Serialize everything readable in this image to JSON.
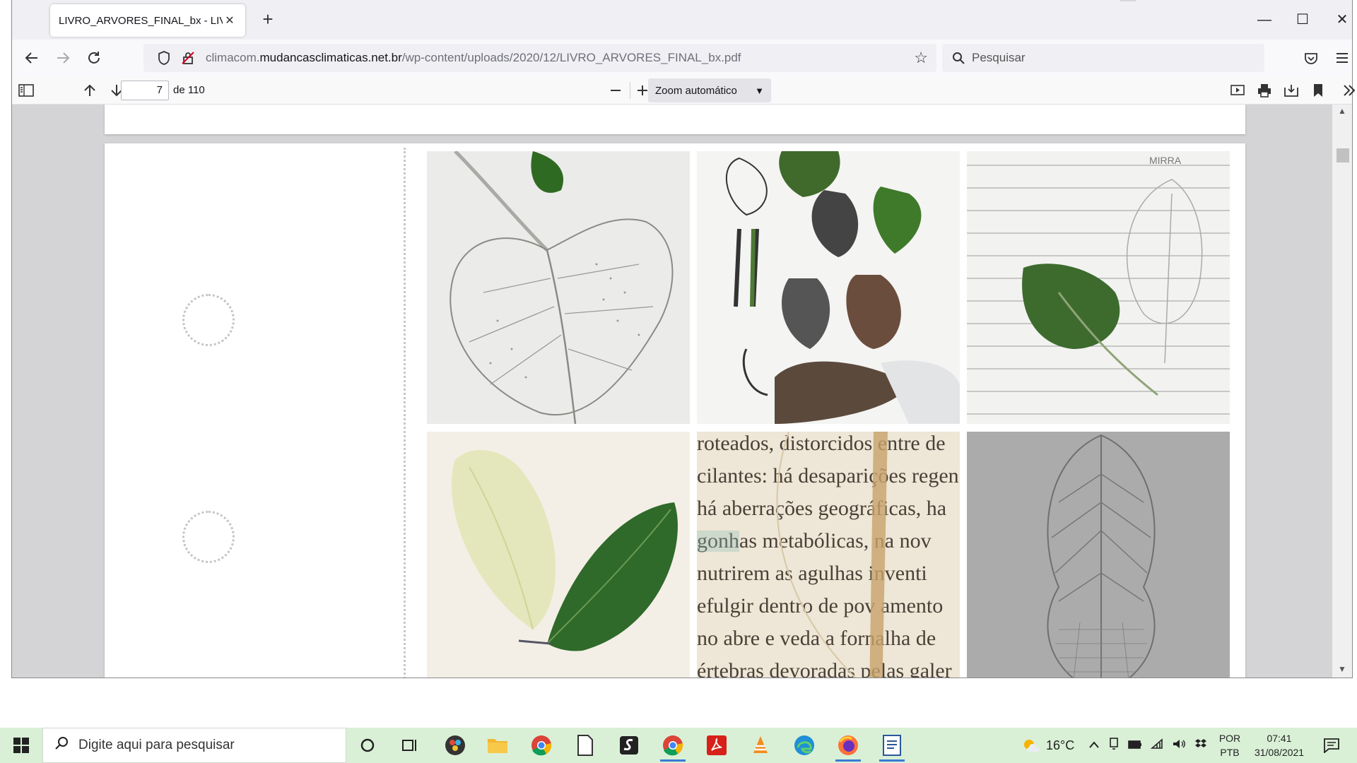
{
  "browser": {
    "tab_title": "LIVRO_ARVORES_FINAL_bx - LIVRO_",
    "url_prefix": "climacom.",
    "url_domain": "mudancasclimaticas.net.br",
    "url_path": "/wp-content/uploads/2020/12/LIVRO_ARVORES_FINAL_bx.pdf",
    "search_placeholder": "Pesquisar"
  },
  "pdf": {
    "current_page": "7",
    "total_label": "de 110",
    "zoom_label": "Zoom automático"
  },
  "page_content": {
    "photo_captions": [
      "pencil leaf drawing",
      "leaf stamps collage",
      "leaf on lined paper with sketch",
      "pressed leaves",
      "leaf skeleton over text",
      "leaf pencil sketch"
    ],
    "mirra_label": "MIRRA",
    "text_lines": [
      "roteados, distorcidos entre de",
      "cilantes: há desaparições regen",
      "há aberrações geográficas, ha",
      "gonhas metabólicas, na nov",
      "nutrirem as agulhas inventi",
      "efulgir dentro de pov amento",
      "no abre e veda a fornalha de",
      "értebras devoradas pelas galer"
    ]
  },
  "taskbar": {
    "search_placeholder": "Digite aqui para pesquisar",
    "weather": "16°C",
    "lang_top": "POR",
    "lang_bottom": "PTB",
    "time": "07:41",
    "date": "31/08/2021"
  }
}
